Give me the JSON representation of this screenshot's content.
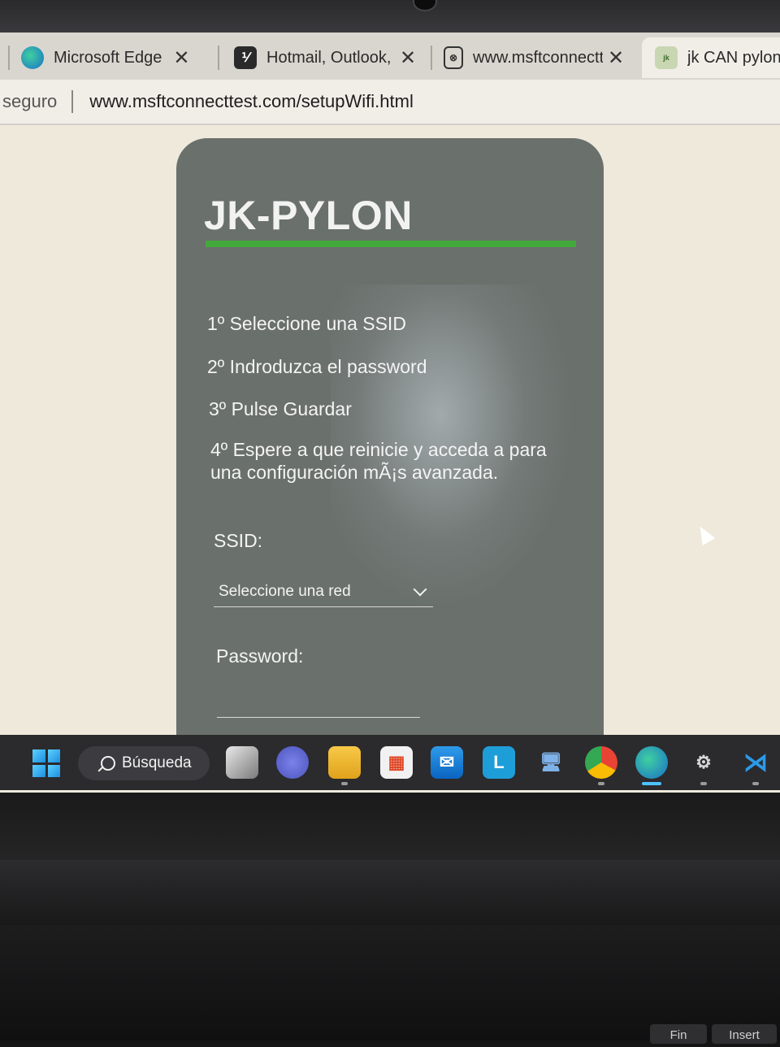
{
  "browser": {
    "tabs": [
      {
        "title": "Microsoft Edge",
        "icon": "edge-icon",
        "closable": true
      },
      {
        "title": "Hotmail, Outlook, n",
        "icon": "outlook-icon",
        "closable": true
      },
      {
        "title": "www.msftconnectte",
        "icon": "page-error-icon",
        "closable": true
      },
      {
        "title": "jk CAN pylon",
        "icon": "jk-pylon-favicon",
        "closable": false,
        "active": true
      }
    ],
    "address": {
      "security_label": "seguro",
      "url": "www.msftconnecttest.com/setupWifi.html"
    }
  },
  "page": {
    "title": "JK-PYLON",
    "accent_color": "#43a93c",
    "steps": [
      "1º Seleccione una SSID",
      "2º Indroduzca el password",
      "3º Pulse Guardar",
      "4º Espere a que reinicie y acceda a para una configuración mÃ¡s avanzada."
    ],
    "ssid_label": "SSID:",
    "ssid_selected": "Seleccione una red",
    "password_label": "Password:",
    "password_value": ""
  },
  "taskbar": {
    "search_label": "Búsqueda",
    "apps": [
      "task-view-icon",
      "teams-icon",
      "file-explorer-icon",
      "microsoft-store-icon",
      "mail-icon",
      "l-app-icon",
      "remote-desktop-icon",
      "chrome-icon",
      "edge-icon",
      "network-tool-icon",
      "vscode-icon"
    ]
  },
  "keyboard": {
    "keys": [
      "Fin",
      "Insert"
    ]
  }
}
